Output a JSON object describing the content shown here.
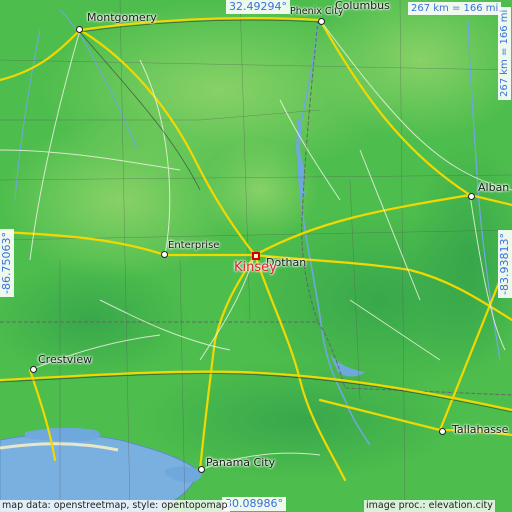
{
  "map": {
    "place": "Kinsey",
    "cities": [
      {
        "id": "montgomery",
        "name": "Montgomery"
      },
      {
        "id": "phenix-city",
        "name": "Phenix City"
      },
      {
        "id": "columbus",
        "name": "Columbus"
      },
      {
        "id": "albany",
        "name": "Alban"
      },
      {
        "id": "enterprise",
        "name": "Enterprise"
      },
      {
        "id": "dothan",
        "name": "Dothan"
      },
      {
        "id": "crestview",
        "name": "Crestview"
      },
      {
        "id": "panama-city",
        "name": "Panama City"
      },
      {
        "id": "tallahassee",
        "name": "Tallahasse"
      }
    ],
    "coords": {
      "top": "32.49294°",
      "bottom": "30.08986°",
      "left": "-86.75063°",
      "right": "-83.93813°"
    },
    "scale": {
      "horizontal": "267 km = 166 mi",
      "vertical": "267 km = 166 mi"
    },
    "credits": {
      "left": "map data: openstreetmap, style: opentopomap",
      "right": "image proc.: elevation.city"
    },
    "colors": {
      "land": "#4fbf4f",
      "water": "#6fa8dc",
      "roads": "#f0d000",
      "marker": "#d00000",
      "coord_text": "#3a6fdc"
    }
  }
}
